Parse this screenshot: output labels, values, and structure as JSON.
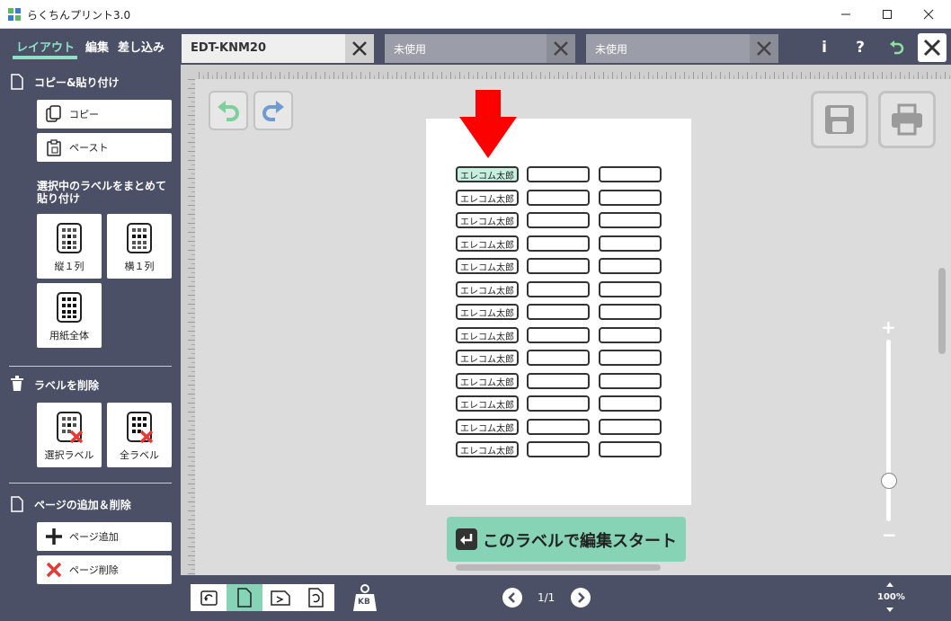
{
  "window": {
    "title": "らくちんプリント3.0"
  },
  "modes": [
    {
      "label": "レイアウト",
      "active": true
    },
    {
      "label": "編集",
      "active": false
    },
    {
      "label": "差し込み",
      "active": false
    }
  ],
  "doc_tabs": [
    {
      "label": "EDT-KNM20",
      "active": true
    },
    {
      "label": "未使用",
      "active": false
    },
    {
      "label": "未使用",
      "active": false
    }
  ],
  "header_icons": {
    "info": "i",
    "help": "?"
  },
  "sidebar": {
    "copy_paste": {
      "title": "コピー&貼り付け",
      "copy_label": "コピー",
      "paste_label": "ペースト",
      "bulk_title": "選択中のラベルをまとめて貼り付け",
      "tiles": [
        {
          "label": "縦１列",
          "icon": "column-grid-icon"
        },
        {
          "label": "横１列",
          "icon": "row-grid-icon"
        },
        {
          "label": "用紙全体",
          "icon": "full-sheet-grid-icon"
        }
      ]
    },
    "delete": {
      "title": "ラベルを削除",
      "tiles": [
        {
          "label": "選択ラベル",
          "icon": "delete-selected-icon"
        },
        {
          "label": "全ラベル",
          "icon": "delete-all-icon"
        }
      ]
    },
    "pages": {
      "title": "ページの追加＆削除",
      "add_label": "ページ追加",
      "delete_label": "ページ削除"
    }
  },
  "sheet": {
    "label_text": "エレコム太郎",
    "rows": 13,
    "cols": 3,
    "selected": "row-1-col-1"
  },
  "start_button": {
    "label": "このラベルで編集スタート"
  },
  "footer": {
    "page": "1/1",
    "zoom": "100%",
    "weight_badge": "KB"
  },
  "colors": {
    "accent": "#86d3b6",
    "header": "#4b5066",
    "arrow": "#ff0000"
  }
}
